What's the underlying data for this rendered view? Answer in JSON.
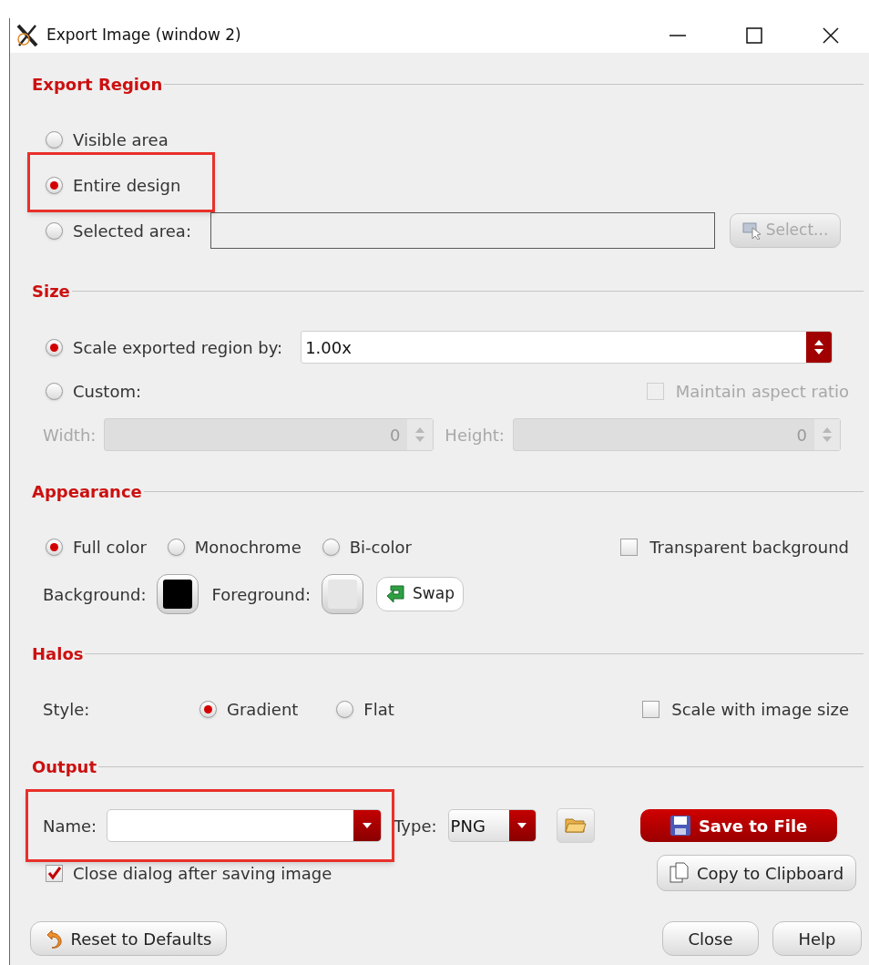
{
  "window": {
    "title": "Export Image (window 2)"
  },
  "export_region": {
    "title": "Export Region",
    "options": [
      {
        "label": "Visible area",
        "selected": false,
        "highlighted": false
      },
      {
        "label": "Entire design",
        "selected": true,
        "highlighted": true
      },
      {
        "label": "Selected area:",
        "selected": false,
        "highlighted": false
      }
    ],
    "select_button": {
      "label": "Select...",
      "disabled": true
    }
  },
  "size": {
    "title": "Size",
    "options": [
      {
        "label": "Scale exported region by:",
        "selected": true
      },
      {
        "label": "Custom:",
        "selected": false
      }
    ],
    "scale_value": "1.00x",
    "maintain_aspect_ratio": {
      "label": "Maintain aspect ratio",
      "checked": false,
      "disabled": true
    },
    "width": {
      "label": "Width:",
      "value": "0",
      "disabled": true
    },
    "height": {
      "label": "Height:",
      "value": "0",
      "disabled": true
    }
  },
  "appearance": {
    "title": "Appearance",
    "modes": [
      {
        "label": "Full color",
        "selected": true
      },
      {
        "label": "Monochrome",
        "selected": false
      },
      {
        "label": "Bi-color",
        "selected": false
      }
    ],
    "transparent_background": {
      "label": "Transparent background",
      "checked": false
    },
    "background": {
      "label": "Background:",
      "color": "#000000"
    },
    "foreground": {
      "label": "Foreground:",
      "color": "#e6e6e6"
    },
    "swap_button": "Swap"
  },
  "halos": {
    "title": "Halos",
    "style_label": "Style:",
    "styles": [
      {
        "label": "Gradient",
        "selected": true
      },
      {
        "label": "Flat",
        "selected": false
      }
    ],
    "scale_with_image_size": {
      "label": "Scale with image size",
      "checked": false
    }
  },
  "output": {
    "title": "Output",
    "name": {
      "label": "Name:",
      "highlighted": true
    },
    "type": {
      "label": "Type:",
      "value": "PNG"
    },
    "save_button": "Save to File",
    "copy_button": "Copy to Clipboard",
    "close_after_saving": {
      "label": "Close dialog after saving image",
      "checked": true
    }
  },
  "buttons": {
    "reset": "Reset to Defaults",
    "close": "Close",
    "help": "Help"
  }
}
